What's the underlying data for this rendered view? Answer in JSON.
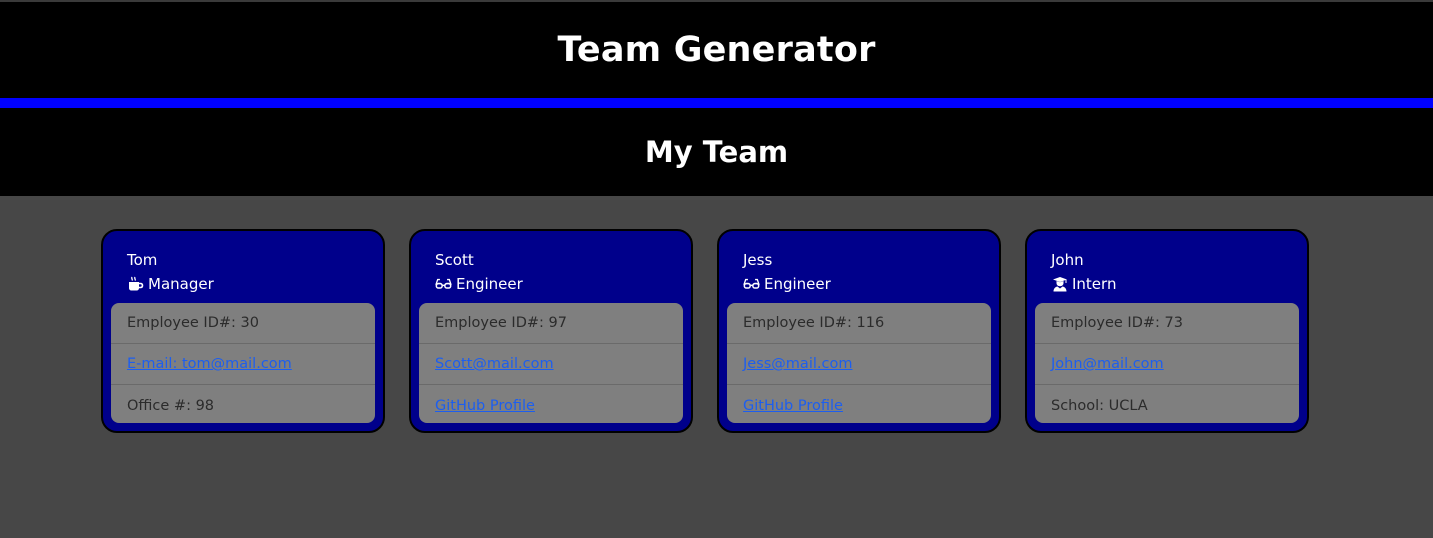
{
  "header": {
    "title": "Team Generator"
  },
  "subheader": {
    "title": "My Team"
  },
  "cards": [
    {
      "name": "Tom",
      "role": "Manager",
      "role_icon": "mug-icon",
      "id_text": "Employee ID#: 30",
      "email_text": "E-mail: tom@mail.com",
      "extra_text": "Office #: 98"
    },
    {
      "name": "Scott",
      "role": "Engineer",
      "role_icon": "glasses-icon",
      "id_text": "Employee ID#: 97",
      "email_text": "Scott@mail.com",
      "extra_text": "GitHub Profile"
    },
    {
      "name": "Jess",
      "role": "Engineer",
      "role_icon": "glasses-icon",
      "id_text": "Employee ID#: 116",
      "email_text": "Jess@mail.com",
      "extra_text": "GitHub Profile"
    },
    {
      "name": "John",
      "role": "Intern",
      "role_icon": "graduate-icon",
      "id_text": "Employee ID#: 73",
      "email_text": "John@mail.com",
      "extra_text": "School: UCLA"
    }
  ],
  "colors": {
    "header_bg": "#000000",
    "divider": "#0000ff",
    "page_bg": "#474747",
    "card_bg": "#00008b",
    "card_body_bg": "#7f7f7f",
    "link": "#1c5ef0"
  }
}
